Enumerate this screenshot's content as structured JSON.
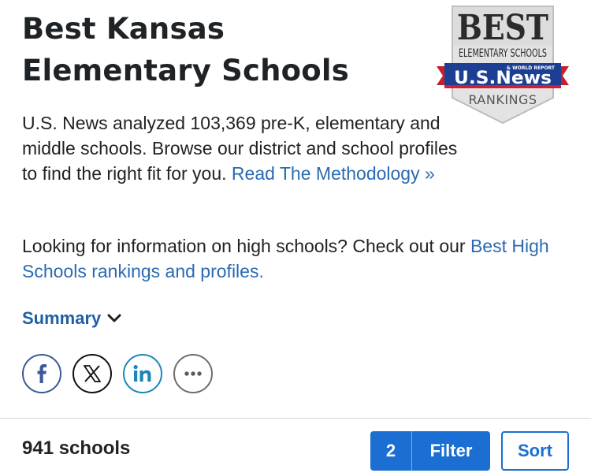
{
  "header": {
    "title_line1": "Best Kansas",
    "title_line2": "Elementary Schools"
  },
  "badge": {
    "best": "BEST",
    "subtitle": "ELEMENTARY SCHOOLS",
    "brand": "U.S.News",
    "tagline": "& WORLD REPORT",
    "rankings": "RANKINGS",
    "brand_colors": {
      "blue": "#1c3f94",
      "red": "#d0202e"
    }
  },
  "intro": {
    "text": "U.S. News analyzed 103,369 pre-K, elementary and middle schools. Browse our district and school profiles to find the right fit for you. ",
    "link": "Read The Methodology »"
  },
  "high_schools": {
    "text": "Looking for information on high schools? Check out our ",
    "link": "Best High Schools rankings and profiles."
  },
  "summary": {
    "label": "Summary",
    "icon": "chevron-down-icon"
  },
  "share": {
    "icons": [
      "facebook-icon",
      "x-icon",
      "linkedin-icon",
      "more-icon"
    ]
  },
  "results": {
    "count_label": "941 schools",
    "filter_count": "2",
    "filter_label": "Filter",
    "sort_label": "Sort"
  },
  "colors": {
    "link": "#2a6ab1",
    "accent": "#1b6fd2"
  }
}
